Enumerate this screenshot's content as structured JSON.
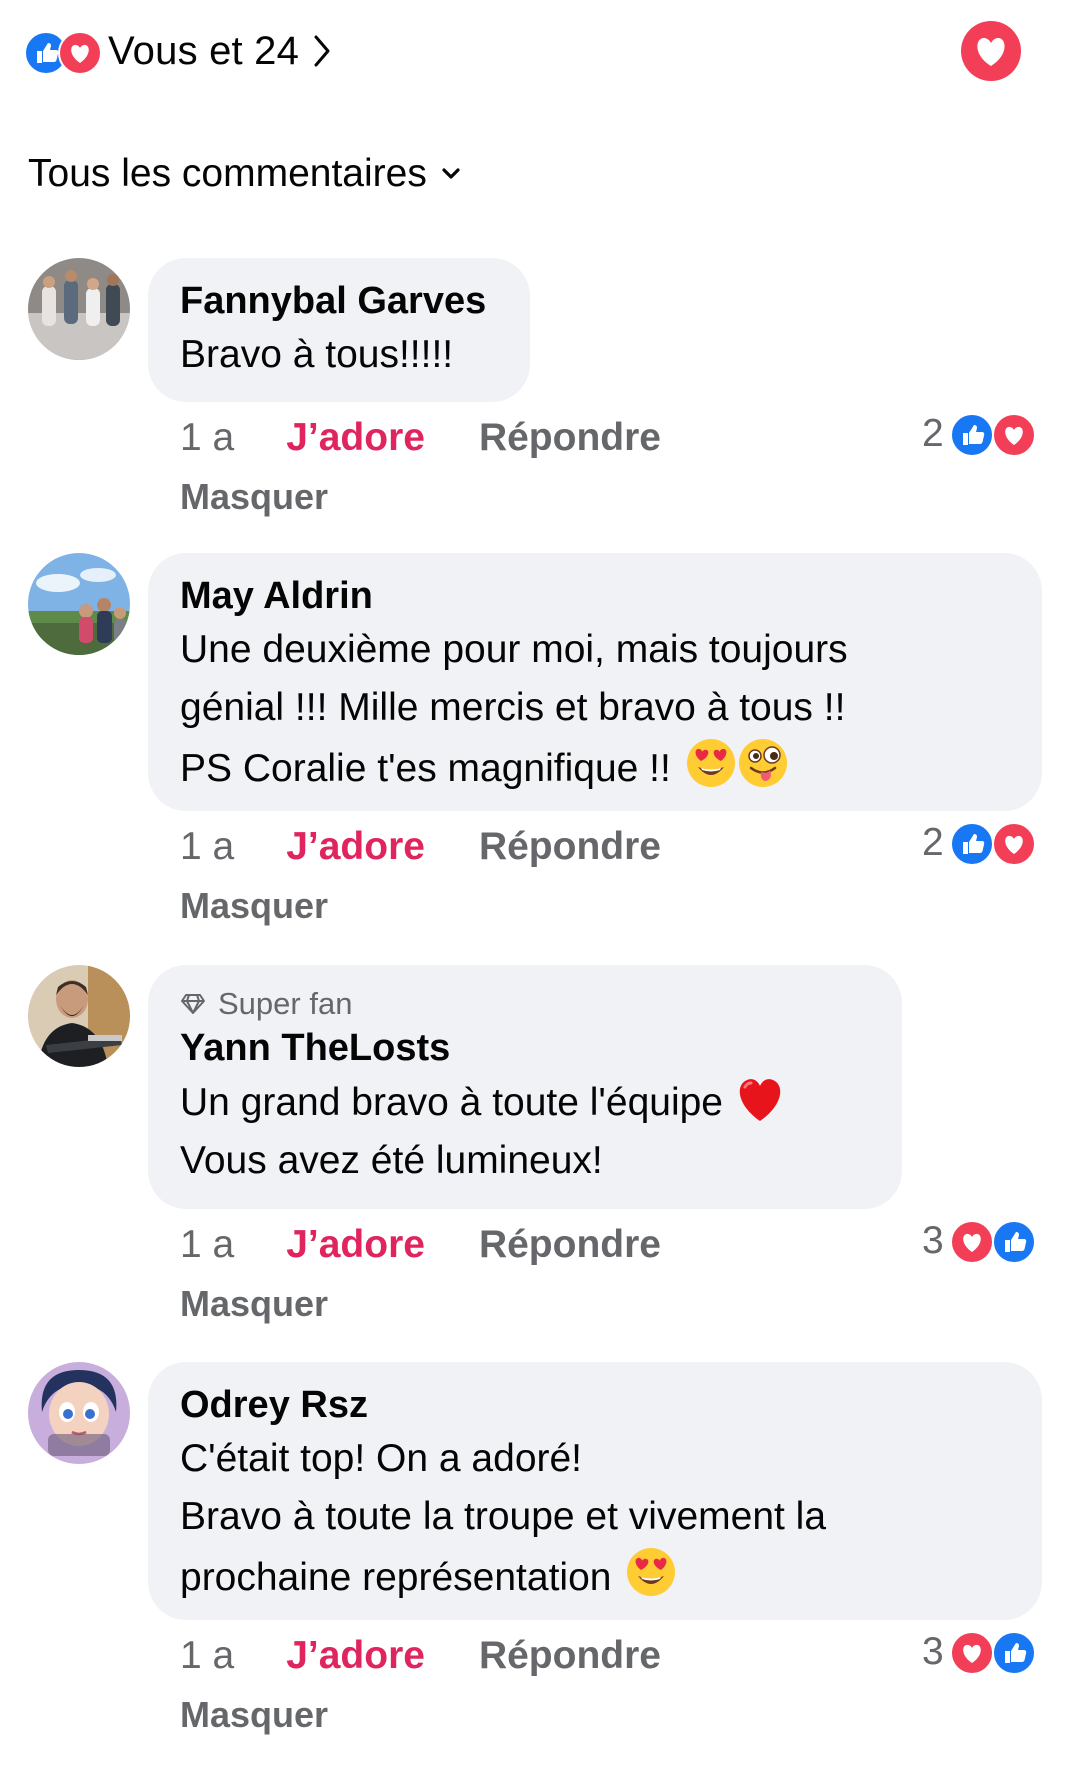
{
  "header": {
    "reactions_label": "Vous et 24",
    "reaction_icons": [
      "like-icon",
      "love-icon"
    ],
    "sort_label": "Tous les commentaires"
  },
  "colors": {
    "like_blue": "#1877f2",
    "love_red": "#f33e58",
    "adore_active": "#e0245e",
    "secondary_text": "#65676b",
    "bubble_bg": "#f0f2f5"
  },
  "comments": [
    {
      "author": "Fannybal Garves",
      "text": "Bravo à tous!!!!!",
      "time": "1 a",
      "like_label": "J’adore",
      "reply_label": "Répondre",
      "hide_label": "Masquer",
      "reaction_count": "2",
      "reaction_icons": [
        "like-icon",
        "love-icon"
      ]
    },
    {
      "author": "May Aldrin",
      "text_lines": [
        "Une deuxième pour moi, mais toujours",
        "génial !!! Mille mercis et bravo à tous !!",
        "PS Coralie t'es magnifique !!"
      ],
      "emojis": [
        "heart-eyes-emoji",
        "winking-tongue-emoji"
      ],
      "time": "1 a",
      "like_label": "J’adore",
      "reply_label": "Répondre",
      "hide_label": "Masquer",
      "reaction_count": "2",
      "reaction_icons": [
        "like-icon",
        "love-icon"
      ]
    },
    {
      "badge": "Super fan",
      "author": "Yann TheLosts",
      "text_lines": [
        "Un grand bravo à toute l'équipe",
        "Vous avez été lumineux!"
      ],
      "emojis": [
        "red-heart-emoji"
      ],
      "time": "1 a",
      "like_label": "J’adore",
      "reply_label": "Répondre",
      "hide_label": "Masquer",
      "reaction_count": "3",
      "reaction_icons": [
        "love-icon",
        "like-icon"
      ]
    },
    {
      "author": "Odrey Rsz",
      "text_lines": [
        "C'était top! On a adoré!",
        "Bravo à toute la troupe et vivement la",
        "prochaine représentation"
      ],
      "emojis": [
        "heart-eyes-emoji"
      ],
      "time": "1 a",
      "like_label": "J’adore",
      "reply_label": "Répondre",
      "hide_label": "Masquer",
      "reaction_count": "3",
      "reaction_icons": [
        "love-icon",
        "like-icon"
      ]
    }
  ]
}
